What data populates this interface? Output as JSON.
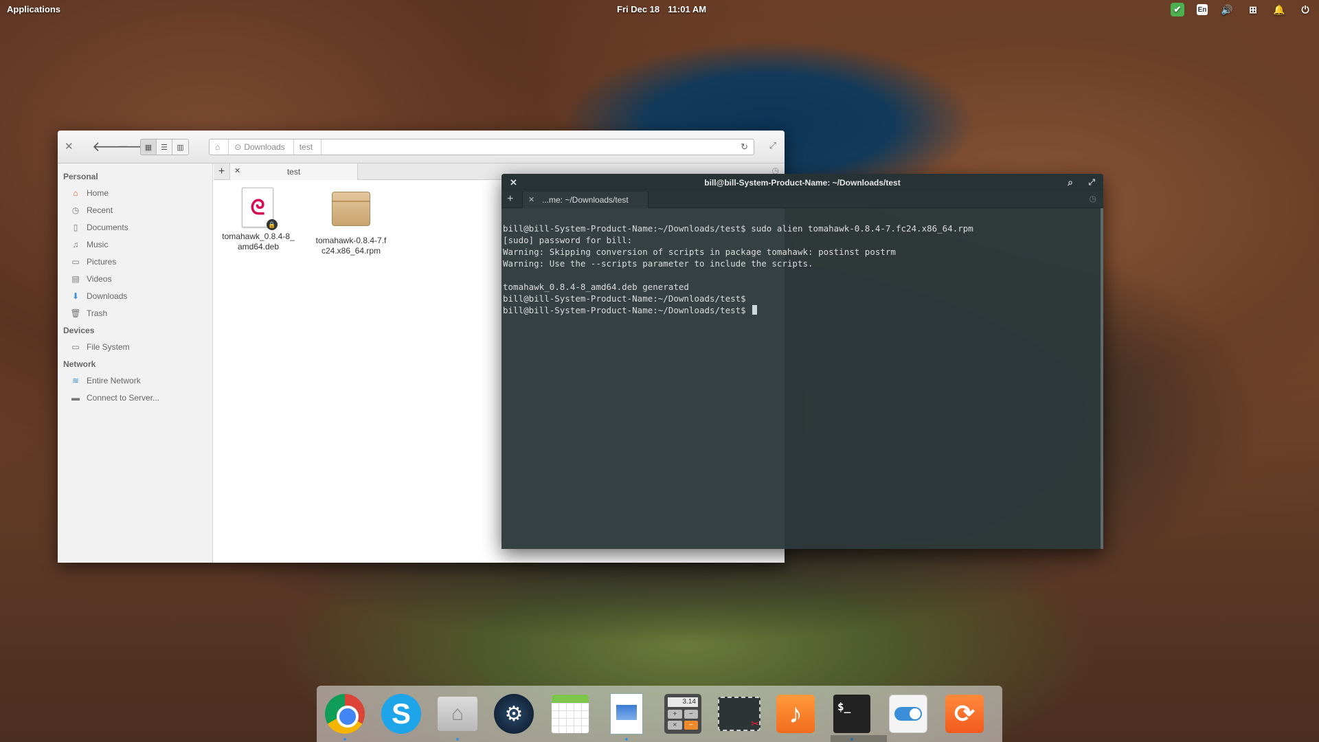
{
  "top_panel": {
    "applications_label": "Applications",
    "date": "Fri Dec 18",
    "time": "11:01 AM",
    "indicators": [
      "check-icon",
      "keyboard-layout-icon",
      "volume-icon",
      "network-icon",
      "notifications-icon",
      "power-icon"
    ],
    "keyboard_layout": "En"
  },
  "file_manager": {
    "path": [
      "Downloads",
      "test"
    ],
    "tab_label": "test",
    "sidebar": {
      "personal_header": "Personal",
      "personal": [
        {
          "label": "Home",
          "icon": "home-icon"
        },
        {
          "label": "Recent",
          "icon": "recent-icon"
        },
        {
          "label": "Documents",
          "icon": "documents-icon"
        },
        {
          "label": "Music",
          "icon": "music-icon"
        },
        {
          "label": "Pictures",
          "icon": "pictures-icon"
        },
        {
          "label": "Videos",
          "icon": "videos-icon"
        },
        {
          "label": "Downloads",
          "icon": "downloads-icon"
        },
        {
          "label": "Trash",
          "icon": "trash-icon"
        }
      ],
      "devices_header": "Devices",
      "devices": [
        {
          "label": "File System",
          "icon": "drive-icon"
        }
      ],
      "network_header": "Network",
      "network": [
        {
          "label": "Entire Network",
          "icon": "wifi-icon"
        },
        {
          "label": "Connect to Server...",
          "icon": "server-icon"
        }
      ]
    },
    "files": [
      {
        "name_line1": "tomahawk_0.8.4-8_",
        "name_line2": "amd64.deb",
        "icon": "debian-package-icon"
      },
      {
        "name_line1": "tomahawk-0.8.4-7.f",
        "name_line2": "c24.x86_64.rpm",
        "icon": "package-box-icon"
      }
    ]
  },
  "terminal": {
    "title": "bill@bill-System-Product-Name: ~/Downloads/test",
    "tab_label": "...me: ~/Downloads/test",
    "lines": [
      "bill@bill-System-Product-Name:~/Downloads/test$ sudo alien tomahawk-0.8.4-7.fc24.x86_64.rpm",
      "[sudo] password for bill:",
      "Warning: Skipping conversion of scripts in package tomahawk: postinst postrm",
      "Warning: Use the --scripts parameter to include the scripts.",
      "",
      "tomahawk_0.8.4-8_amd64.deb generated",
      "bill@bill-System-Product-Name:~/Downloads/test$",
      "bill@bill-System-Product-Name:~/Downloads/test$ "
    ]
  },
  "dock": {
    "items": [
      "chrome-icon",
      "skype-icon",
      "files-icon",
      "steam-icon",
      "calendar-icon",
      "document-viewer-icon",
      "calculator-icon",
      "screenshot-icon",
      "music-icon",
      "terminal-icon",
      "switchboard-icon",
      "software-update-icon"
    ],
    "calculator_display": "3.14",
    "terminal_prompt": "$_"
  }
}
